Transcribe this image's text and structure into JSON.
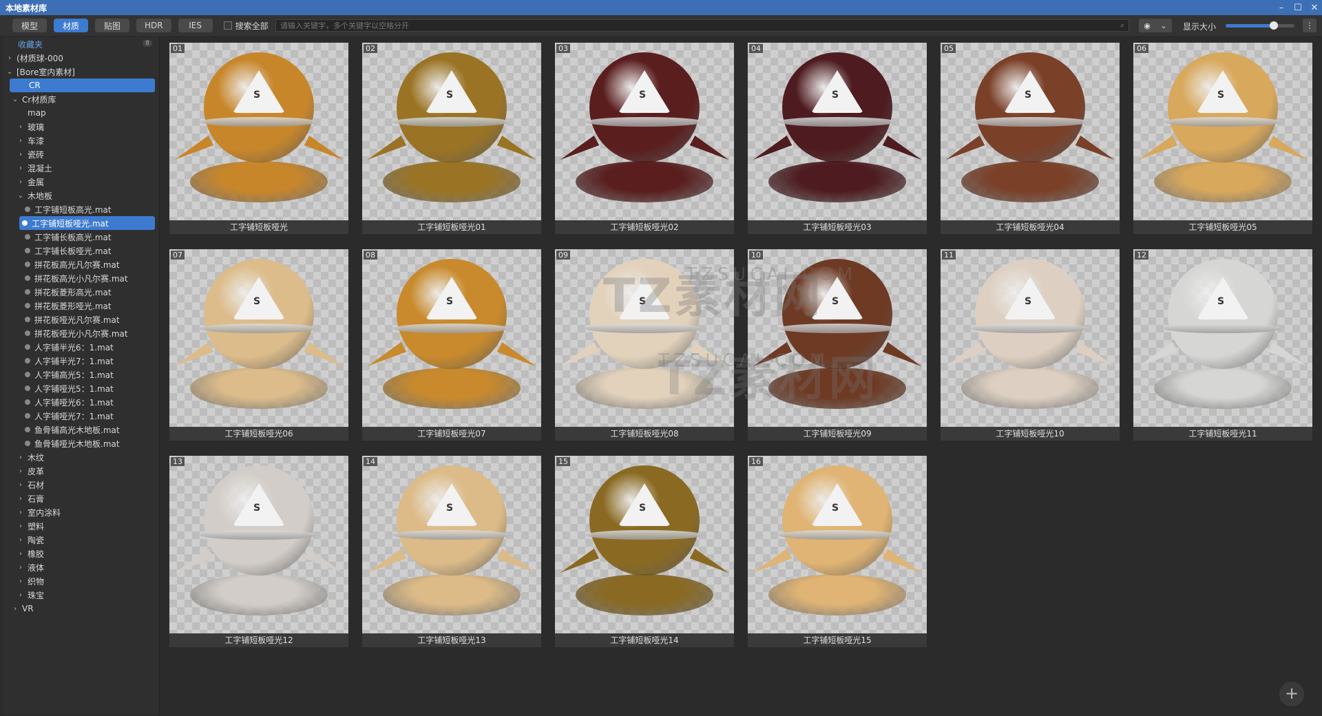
{
  "window": {
    "title": "本地素材库",
    "controls": [
      "–",
      "☐",
      "✕"
    ]
  },
  "toolbar": {
    "tabs": [
      {
        "label": "模型",
        "active": false
      },
      {
        "label": "材质",
        "active": true
      },
      {
        "label": "贴图",
        "active": false
      },
      {
        "label": "HDR",
        "active": false
      },
      {
        "label": "IES",
        "active": false
      }
    ],
    "search_all_label": "搜索全部",
    "search_placeholder": "请输入关键字，多个关键字以空格分开",
    "camera_icon": "camera-icon",
    "size_label": "显示大小",
    "size_value": 0.7,
    "accent_color": "#3d7bd0"
  },
  "sidebar": {
    "favorites": {
      "label": "收藏夹",
      "count": "8"
    },
    "tree": [
      {
        "label": "(材质球-000",
        "level": 0,
        "arrow": "›"
      },
      {
        "label": "[Bore室内素材]",
        "level": 0,
        "arrow": "⌄"
      },
      {
        "label": "CR",
        "level": 1,
        "arrow": "",
        "selected": true
      },
      {
        "label": "Cr材质库",
        "level": 1,
        "arrow": "⌄"
      },
      {
        "label": "map",
        "level": 2,
        "arrow": ""
      },
      {
        "label": "玻璃",
        "level": 2,
        "arrow": "›"
      },
      {
        "label": "车漆",
        "level": 2,
        "arrow": "›"
      },
      {
        "label": "瓷砖",
        "level": 2,
        "arrow": "›"
      },
      {
        "label": "混凝土",
        "level": 2,
        "arrow": "›"
      },
      {
        "label": "金属",
        "level": 2,
        "arrow": "›"
      },
      {
        "label": "木地板",
        "level": 2,
        "arrow": "⌄"
      },
      {
        "label": "工字铺短板高光.mat",
        "level": 3,
        "dot": true
      },
      {
        "label": "工字铺短板哑光.mat",
        "level": 3,
        "dot": true,
        "selected": true
      },
      {
        "label": "工字铺长板高光.mat",
        "level": 3,
        "dot": true
      },
      {
        "label": "工字铺长板哑光.mat",
        "level": 3,
        "dot": true
      },
      {
        "label": "拼花板高光凡尔赛.mat",
        "level": 3,
        "dot": true
      },
      {
        "label": "拼花板高光小凡尔赛.mat",
        "level": 3,
        "dot": true
      },
      {
        "label": "拼花板菱形高光.mat",
        "level": 3,
        "dot": true
      },
      {
        "label": "拼花板菱形哑光.mat",
        "level": 3,
        "dot": true
      },
      {
        "label": "拼花板哑光凡尔赛.mat",
        "level": 3,
        "dot": true
      },
      {
        "label": "拼花板哑光小凡尔赛.mat",
        "level": 3,
        "dot": true
      },
      {
        "label": "人字铺半光6：1.mat",
        "level": 3,
        "dot": true
      },
      {
        "label": "人字铺半光7：1.mat",
        "level": 3,
        "dot": true
      },
      {
        "label": "人字铺高光5：1.mat",
        "level": 3,
        "dot": true
      },
      {
        "label": "人字铺哑光5：1.mat",
        "level": 3,
        "dot": true
      },
      {
        "label": "人字铺哑光6：1.mat",
        "level": 3,
        "dot": true
      },
      {
        "label": "人字铺哑光7：1.mat",
        "level": 3,
        "dot": true
      },
      {
        "label": "鱼骨铺高光木地板.mat",
        "level": 3,
        "dot": true
      },
      {
        "label": "鱼骨铺哑光木地板.mat",
        "level": 3,
        "dot": true
      },
      {
        "label": "木纹",
        "level": 2,
        "arrow": "›"
      },
      {
        "label": "皮革",
        "level": 2,
        "arrow": "›"
      },
      {
        "label": "石材",
        "level": 2,
        "arrow": "›"
      },
      {
        "label": "石膏",
        "level": 2,
        "arrow": "›"
      },
      {
        "label": "室内涂料",
        "level": 2,
        "arrow": "›"
      },
      {
        "label": "塑料",
        "level": 2,
        "arrow": "›"
      },
      {
        "label": "陶瓷",
        "level": 2,
        "arrow": "›"
      },
      {
        "label": "橡胶",
        "level": 2,
        "arrow": "›"
      },
      {
        "label": "液体",
        "level": 2,
        "arrow": "›"
      },
      {
        "label": "织物",
        "level": 2,
        "arrow": "›"
      },
      {
        "label": "珠宝",
        "level": 2,
        "arrow": "›"
      },
      {
        "label": "VR",
        "level": 1,
        "arrow": "›"
      }
    ]
  },
  "materials": [
    {
      "num": "01",
      "label": "工字铺短板哑光",
      "color": "#c8862a"
    },
    {
      "num": "02",
      "label": "工字铺短板哑光01",
      "color": "#9a7424"
    },
    {
      "num": "03",
      "label": "工字铺短板哑光02",
      "color": "#5a1e1e"
    },
    {
      "num": "04",
      "label": "工字铺短板哑光03",
      "color": "#4e1c20"
    },
    {
      "num": "05",
      "label": "工字铺短板哑光04",
      "color": "#7a4028"
    },
    {
      "num": "06",
      "label": "工字铺短板哑光05",
      "color": "#d8a85c"
    },
    {
      "num": "07",
      "label": "工字铺短板哑光06",
      "color": "#dcbc8a"
    },
    {
      "num": "08",
      "label": "工字铺短板哑光07",
      "color": "#c88a2c"
    },
    {
      "num": "09",
      "label": "工字铺短板哑光08",
      "color": "#e2d2bc"
    },
    {
      "num": "10",
      "label": "工字铺短板哑光09",
      "color": "#6e3a24"
    },
    {
      "num": "11",
      "label": "工字铺短板哑光10",
      "color": "#ddd0c2"
    },
    {
      "num": "12",
      "label": "工字铺短板哑光11",
      "color": "#d6d6d4"
    },
    {
      "num": "13",
      "label": "工字铺短板哑光12",
      "color": "#d2cdc8"
    },
    {
      "num": "14",
      "label": "工字铺短板哑光13",
      "color": "#dcbb88"
    },
    {
      "num": "15",
      "label": "工字铺短板哑光14",
      "color": "#8a6a22"
    },
    {
      "num": "16",
      "label": "工字铺短板哑光15",
      "color": "#e0b474"
    }
  ],
  "watermark": {
    "text": "TZ素材网",
    "sub": "TZSUCAI.COM"
  },
  "fab_icon": "plus-icon"
}
